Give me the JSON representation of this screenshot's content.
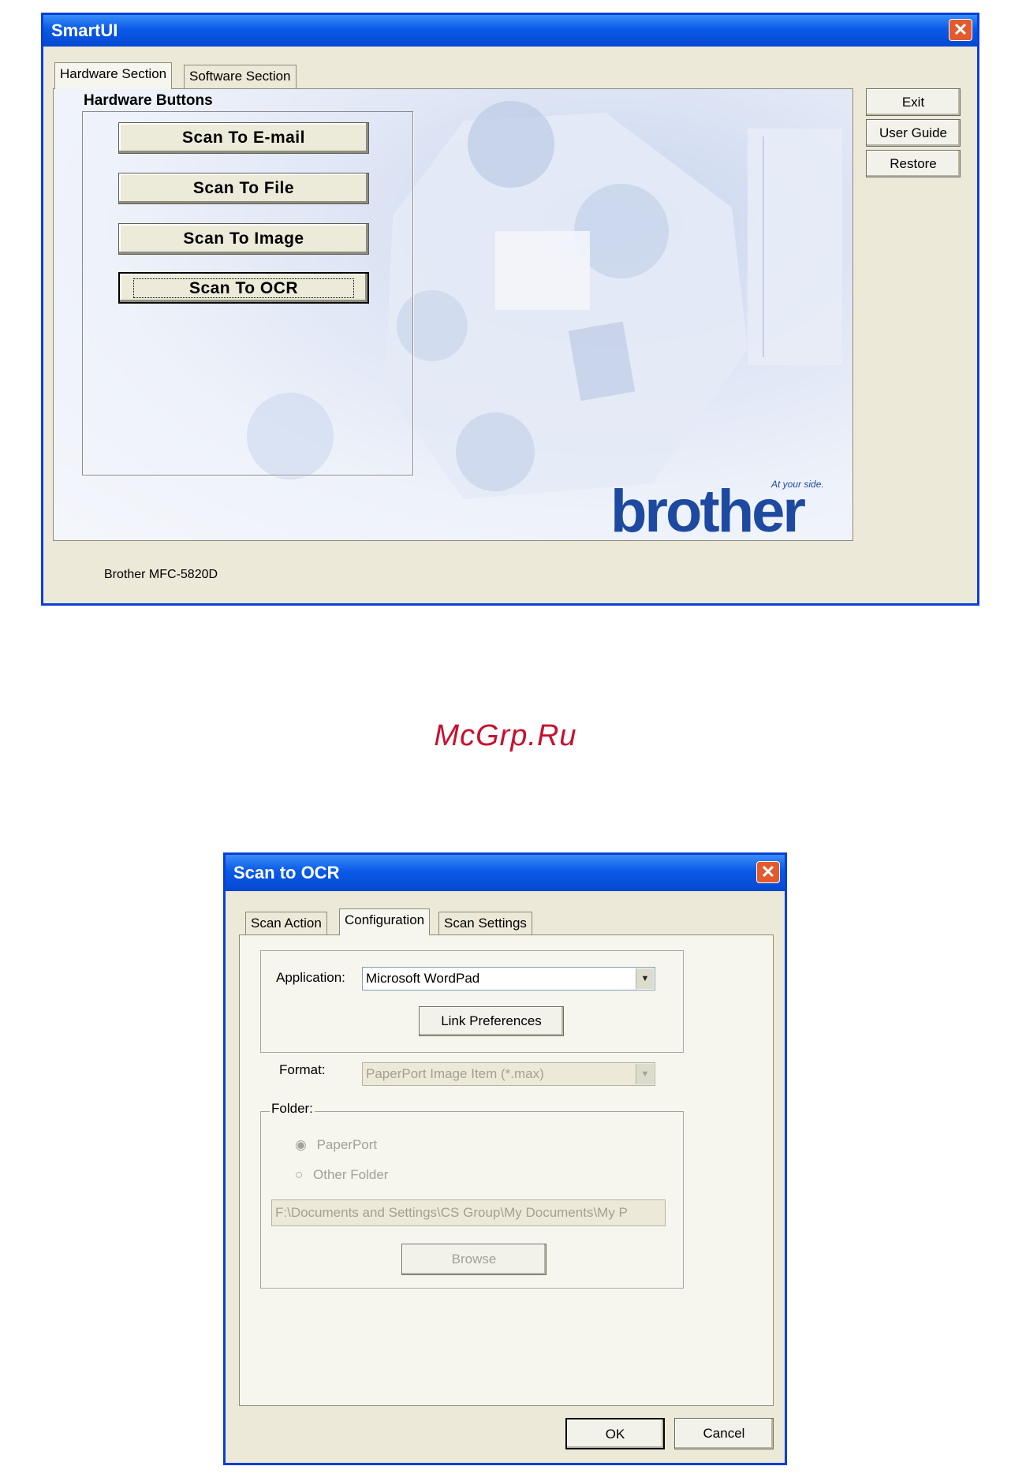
{
  "smartui": {
    "title": "SmartUI",
    "close_glyph": "✕",
    "tabs": [
      {
        "label": "Hardware Section",
        "active": true
      },
      {
        "label": "Software Section",
        "active": false
      }
    ],
    "group_label": "Hardware Buttons",
    "scan_buttons": [
      {
        "label": "Scan To E-mail"
      },
      {
        "label": "Scan To File"
      },
      {
        "label": "Scan To Image"
      },
      {
        "label": "Scan To OCR",
        "focused": true
      }
    ],
    "side_buttons": [
      {
        "label": "Exit"
      },
      {
        "label": "User Guide"
      },
      {
        "label": "Restore"
      }
    ],
    "brand": {
      "name": "brother",
      "tagline": "At your side."
    },
    "status_text": "Brother MFC-5820D"
  },
  "watermark": "McGrp.Ru",
  "ocr_dialog": {
    "title": "Scan to OCR",
    "close_glyph": "✕",
    "tabs": [
      {
        "label": "Scan Action",
        "active": false
      },
      {
        "label": "Configuration",
        "active": true
      },
      {
        "label": "Scan Settings",
        "active": false
      }
    ],
    "application_label": "Application:",
    "application_value": "Microsoft WordPad",
    "link_preferences_label": "Link Preferences",
    "format_label": "Format:",
    "format_value": "PaperPort Image Item (*.max)",
    "folder_label": "Folder:",
    "radio_paperport": "PaperPort",
    "radio_other_folder": "Other Folder",
    "folder_path": "F:\\Documents and Settings\\CS Group\\My Documents\\My P",
    "browse_label": "Browse",
    "ok_label": "OK",
    "cancel_label": "Cancel"
  },
  "colors": {
    "titlebar": "#0a5ae8",
    "close_button": "#e35a2e",
    "window_bg": "#ece9d8",
    "brand_blue": "#1d4aa0",
    "watermark_red": "#c8102e"
  }
}
